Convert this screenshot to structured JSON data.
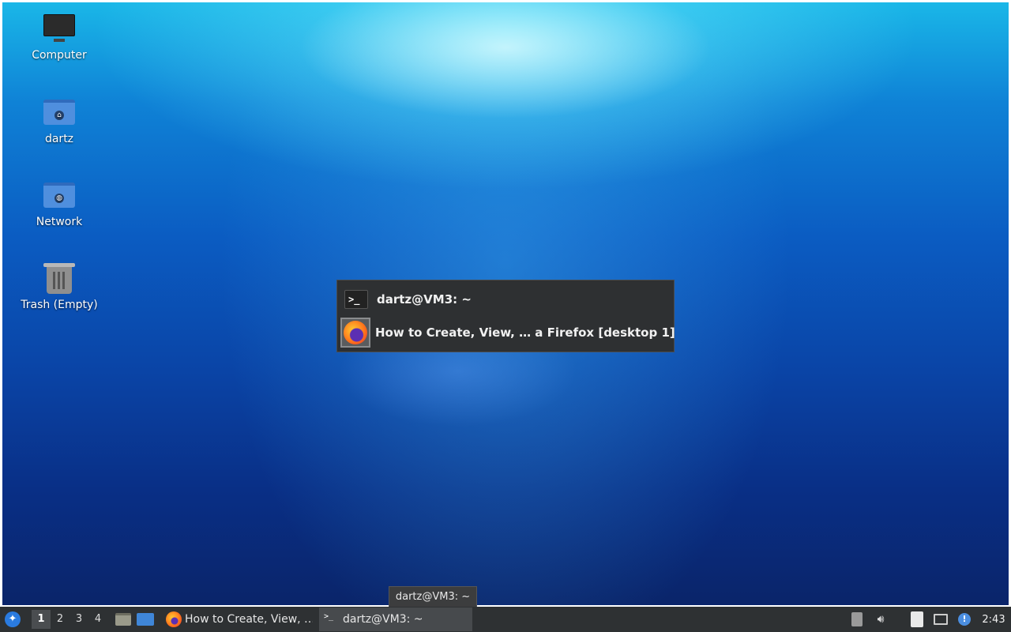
{
  "desktop": {
    "icons": [
      {
        "label": "Computer"
      },
      {
        "label": "dartz"
      },
      {
        "label": "Network"
      },
      {
        "label": "Trash (Empty)"
      }
    ]
  },
  "switcher": {
    "items": [
      {
        "title": "dartz@VM3: ~",
        "icon": "terminal-icon"
      },
      {
        "title": "How to Create, View, … a Firefox [desktop 1]",
        "icon": "firefox-icon"
      }
    ]
  },
  "tooltip": {
    "text": "dartz@VM3: ~"
  },
  "taskbar": {
    "workspaces": [
      "1",
      "2",
      "3",
      "4"
    ],
    "active_workspace": "1",
    "tasks": [
      {
        "label": "How to Create, View, …",
        "icon": "firefox-icon"
      },
      {
        "label": "dartz@VM3: ~",
        "icon": "terminal-icon"
      }
    ],
    "clock": "2:43"
  }
}
